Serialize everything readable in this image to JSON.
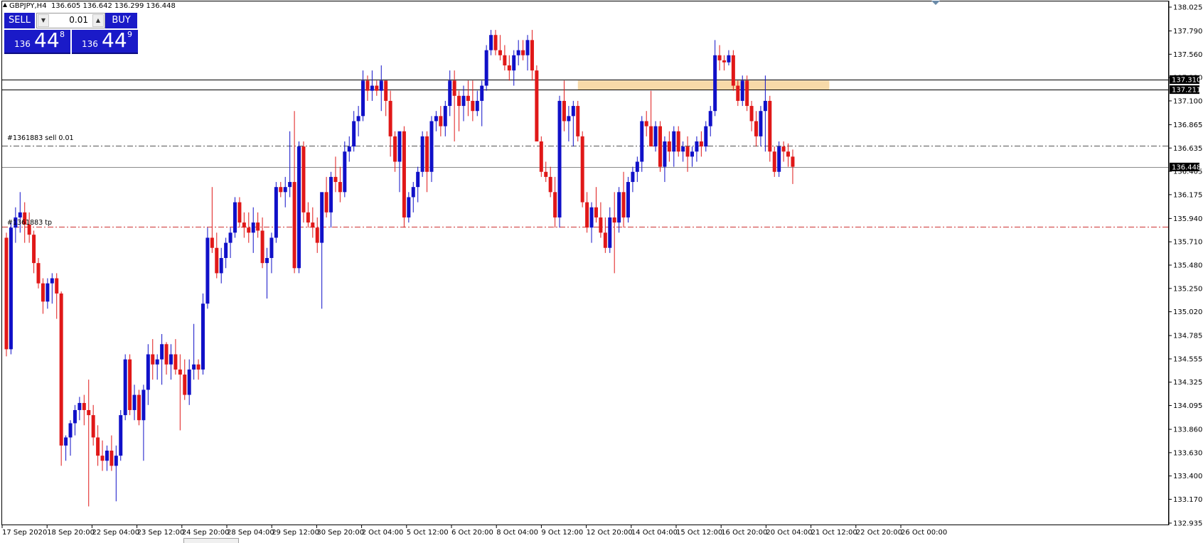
{
  "header": {
    "symbol": "GBPJPY,H4",
    "ohlc": "136.605 136.642 136.299 136.448"
  },
  "trade_panel": {
    "sell_label": "SELL",
    "buy_label": "BUY",
    "lot_value": "0.01",
    "sell_price": {
      "prefix": "136",
      "big": "44",
      "sup": "8"
    },
    "buy_price": {
      "prefix": "136",
      "big": "44",
      "sup": "9"
    }
  },
  "annotations": {
    "order_line_label": "#1361883 sell 0.01",
    "tp_line_label": "#1361883 tp"
  },
  "colors": {
    "bull": "#1010c8",
    "bear": "#e01818",
    "zone": "#f7d9a8",
    "order_line": "#555555",
    "tp_line": "#cc3333"
  },
  "chart_data": {
    "type": "candlestick",
    "symbol": "GBPJPY",
    "timeframe": "H4",
    "ylim": [
      132.935,
      138.025
    ],
    "y_ticks": [
      138.025,
      137.79,
      137.56,
      137.33,
      137.1,
      136.865,
      136.635,
      136.405,
      136.175,
      135.94,
      135.71,
      135.48,
      135.25,
      135.02,
      134.785,
      134.555,
      134.325,
      134.095,
      133.86,
      133.63,
      133.4,
      133.17,
      132.935
    ],
    "x_labels": [
      "17 Sep 2020",
      "18 Sep 20:00",
      "22 Sep 04:00",
      "23 Sep 12:00",
      "24 Sep 20:00",
      "28 Sep 04:00",
      "29 Sep 12:00",
      "30 Sep 20:00",
      "2 Oct 04:00",
      "5 Oct 12:00",
      "6 Oct 20:00",
      "8 Oct 04:00",
      "9 Oct 12:00",
      "12 Oct 20:00",
      "14 Oct 04:00",
      "15 Oct 12:00",
      "16 Oct 20:00",
      "20 Oct 04:00",
      "21 Oct 12:00",
      "22 Oct 20:00",
      "26 Oct 00:00"
    ],
    "horizontal_lines": [
      {
        "price": 137.31,
        "label": "137.310",
        "style": "solid"
      },
      {
        "price": 137.211,
        "label": "137.211",
        "style": "solid"
      },
      {
        "price": 136.448,
        "label": "136.448",
        "style": "bid"
      },
      {
        "price": 136.655,
        "label": "#1361883 sell 0.01",
        "style": "dashdot"
      },
      {
        "price": 135.86,
        "label": "#1361883 tp",
        "style": "dashdot-red"
      }
    ],
    "zone": {
      "from_candle": 125,
      "to_candle": 180,
      "top": 137.3,
      "bottom": 137.21
    },
    "candles": [
      [
        135.75,
        135.8,
        134.58,
        134.65
      ],
      [
        134.65,
        135.9,
        134.6,
        135.85
      ],
      [
        135.85,
        136.05,
        135.7,
        135.95
      ],
      [
        135.95,
        136.2,
        135.8,
        136.0
      ],
      [
        136.0,
        136.1,
        135.7,
        135.88
      ],
      [
        135.88,
        136.0,
        135.7,
        135.78
      ],
      [
        135.78,
        135.82,
        135.4,
        135.5
      ],
      [
        135.5,
        135.55,
        135.25,
        135.3
      ],
      [
        135.3,
        135.35,
        135.0,
        135.12
      ],
      [
        135.12,
        135.35,
        135.05,
        135.3
      ],
      [
        135.3,
        135.4,
        135.1,
        135.35
      ],
      [
        135.35,
        135.4,
        134.95,
        135.2
      ],
      [
        135.2,
        135.22,
        133.5,
        133.7
      ],
      [
        133.7,
        133.8,
        133.55,
        133.78
      ],
      [
        133.78,
        133.95,
        133.6,
        133.92
      ],
      [
        133.92,
        134.1,
        133.8,
        134.05
      ],
      [
        134.05,
        134.18,
        133.95,
        134.12
      ],
      [
        134.12,
        134.2,
        133.9,
        134.05
      ],
      [
        134.05,
        134.35,
        133.1,
        134.0
      ],
      [
        134.0,
        134.1,
        133.7,
        133.78
      ],
      [
        133.78,
        133.9,
        133.5,
        133.6
      ],
      [
        133.6,
        133.75,
        133.45,
        133.55
      ],
      [
        133.55,
        133.7,
        133.45,
        133.65
      ],
      [
        133.65,
        133.8,
        133.45,
        133.5
      ],
      [
        133.5,
        133.7,
        133.15,
        133.6
      ],
      [
        133.6,
        134.05,
        133.55,
        134.0
      ],
      [
        134.0,
        134.6,
        133.95,
        134.55
      ],
      [
        134.55,
        134.6,
        134.0,
        134.05
      ],
      [
        134.05,
        134.3,
        133.95,
        134.2
      ],
      [
        134.2,
        134.25,
        133.9,
        133.95
      ],
      [
        133.95,
        134.3,
        133.55,
        134.25
      ],
      [
        134.25,
        134.7,
        134.1,
        134.6
      ],
      [
        134.6,
        134.75,
        134.35,
        134.5
      ],
      [
        134.5,
        134.6,
        134.35,
        134.55
      ],
      [
        134.55,
        134.8,
        134.3,
        134.7
      ],
      [
        134.7,
        134.72,
        134.4,
        134.5
      ],
      [
        134.5,
        134.7,
        134.35,
        134.6
      ],
      [
        134.6,
        134.75,
        134.4,
        134.45
      ],
      [
        134.45,
        134.6,
        133.85,
        134.4
      ],
      [
        134.4,
        134.55,
        134.15,
        134.2
      ],
      [
        134.2,
        134.55,
        134.1,
        134.45
      ],
      [
        134.45,
        134.9,
        134.35,
        134.5
      ],
      [
        134.5,
        134.55,
        134.35,
        134.45
      ],
      [
        134.45,
        135.2,
        134.4,
        135.1
      ],
      [
        135.1,
        135.85,
        135.05,
        135.75
      ],
      [
        135.75,
        136.25,
        135.6,
        135.65
      ],
      [
        135.65,
        135.8,
        135.35,
        135.4
      ],
      [
        135.4,
        135.65,
        135.3,
        135.55
      ],
      [
        135.55,
        135.75,
        135.45,
        135.7
      ],
      [
        135.7,
        135.85,
        135.55,
        135.8
      ],
      [
        135.8,
        136.15,
        135.75,
        136.1
      ],
      [
        136.1,
        136.15,
        135.85,
        135.9
      ],
      [
        135.9,
        136.0,
        135.75,
        135.85
      ],
      [
        135.85,
        136.0,
        135.7,
        135.8
      ],
      [
        135.8,
        136.05,
        135.6,
        135.9
      ],
      [
        135.9,
        136.0,
        135.75,
        135.82
      ],
      [
        135.82,
        135.95,
        135.45,
        135.5
      ],
      [
        135.5,
        135.65,
        135.15,
        135.55
      ],
      [
        135.55,
        135.8,
        135.4,
        135.75
      ],
      [
        135.75,
        136.3,
        135.7,
        136.25
      ],
      [
        136.25,
        136.3,
        136.15,
        136.2
      ],
      [
        136.2,
        136.35,
        136.05,
        136.25
      ],
      [
        136.25,
        136.8,
        136.15,
        136.3
      ],
      [
        136.3,
        137.0,
        135.4,
        135.45
      ],
      [
        135.45,
        136.7,
        135.4,
        136.65
      ],
      [
        136.65,
        136.7,
        135.9,
        136.0
      ],
      [
        136.0,
        136.1,
        135.85,
        135.9
      ],
      [
        135.9,
        136.05,
        135.75,
        135.85
      ],
      [
        135.85,
        135.95,
        135.6,
        135.7
      ],
      [
        135.7,
        135.95,
        135.05,
        136.2
      ],
      [
        136.2,
        136.35,
        135.95,
        136.0
      ],
      [
        136.0,
        136.4,
        135.85,
        136.35
      ],
      [
        136.35,
        136.55,
        136.2,
        136.3
      ],
      [
        136.3,
        136.45,
        136.1,
        136.2
      ],
      [
        136.2,
        136.7,
        136.15,
        136.6
      ],
      [
        136.6,
        136.75,
        136.5,
        136.65
      ],
      [
        136.65,
        137.0,
        136.6,
        136.9
      ],
      [
        136.9,
        137.05,
        136.75,
        136.95
      ],
      [
        136.95,
        137.4,
        136.9,
        137.3
      ],
      [
        137.3,
        137.35,
        137.1,
        137.2
      ],
      [
        137.2,
        137.4,
        137.1,
        137.25
      ],
      [
        137.25,
        137.3,
        137.15,
        137.2
      ],
      [
        137.2,
        137.45,
        137.0,
        137.3
      ],
      [
        137.3,
        137.3,
        136.95,
        137.1
      ],
      [
        137.1,
        137.2,
        136.55,
        136.75
      ],
      [
        136.75,
        136.8,
        136.4,
        136.5
      ],
      [
        136.5,
        136.6,
        136.2,
        136.8
      ],
      [
        136.8,
        136.85,
        135.85,
        135.95
      ],
      [
        135.95,
        136.2,
        135.9,
        136.15
      ],
      [
        136.15,
        136.3,
        136.0,
        136.25
      ],
      [
        136.25,
        136.45,
        136.1,
        136.4
      ],
      [
        136.4,
        136.8,
        136.35,
        136.75
      ],
      [
        136.75,
        136.8,
        136.2,
        136.4
      ],
      [
        136.4,
        136.95,
        136.3,
        136.9
      ],
      [
        136.9,
        137.0,
        136.8,
        136.95
      ],
      [
        136.95,
        137.05,
        136.75,
        136.85
      ],
      [
        136.85,
        137.1,
        136.75,
        137.05
      ],
      [
        137.05,
        137.4,
        136.95,
        137.3
      ],
      [
        137.3,
        137.4,
        136.7,
        137.15
      ],
      [
        137.15,
        137.2,
        136.8,
        137.05
      ],
      [
        137.05,
        137.25,
        136.9,
        137.15
      ],
      [
        137.15,
        137.3,
        136.95,
        137.1
      ],
      [
        137.1,
        137.3,
        136.9,
        137.0
      ],
      [
        137.0,
        137.2,
        136.95,
        137.1
      ],
      [
        137.1,
        137.3,
        136.85,
        137.25
      ],
      [
        137.25,
        137.65,
        137.2,
        137.6
      ],
      [
        137.6,
        137.8,
        137.55,
        137.75
      ],
      [
        137.75,
        137.8,
        137.55,
        137.6
      ],
      [
        137.6,
        137.75,
        137.5,
        137.55
      ],
      [
        137.55,
        137.65,
        137.4,
        137.45
      ],
      [
        137.45,
        137.55,
        137.3,
        137.4
      ],
      [
        137.4,
        137.6,
        137.25,
        137.55
      ],
      [
        137.55,
        137.7,
        137.45,
        137.6
      ],
      [
        137.6,
        137.7,
        137.5,
        137.55
      ],
      [
        137.55,
        137.75,
        137.4,
        137.7
      ],
      [
        137.7,
        137.8,
        137.3,
        137.4
      ],
      [
        137.4,
        137.45,
        136.7,
        136.7
      ],
      [
        136.7,
        136.75,
        136.35,
        136.4
      ],
      [
        136.4,
        136.5,
        136.3,
        136.35
      ],
      [
        136.35,
        136.45,
        136.15,
        136.2
      ],
      [
        136.2,
        136.35,
        135.85,
        135.95
      ],
      [
        135.95,
        137.15,
        135.85,
        137.1
      ],
      [
        137.1,
        137.3,
        136.8,
        136.9
      ],
      [
        136.9,
        137.05,
        136.7,
        136.95
      ],
      [
        136.95,
        137.1,
        136.65,
        137.05
      ],
      [
        137.05,
        137.1,
        136.7,
        136.75
      ],
      [
        136.75,
        136.8,
        136.05,
        136.1
      ],
      [
        136.1,
        136.2,
        135.8,
        135.85
      ],
      [
        135.85,
        136.1,
        135.7,
        136.05
      ],
      [
        136.05,
        136.25,
        135.9,
        135.95
      ],
      [
        135.95,
        136.1,
        135.75,
        135.8
      ],
      [
        135.8,
        135.95,
        135.6,
        135.65
      ],
      [
        135.65,
        136.05,
        135.6,
        135.95
      ],
      [
        135.95,
        136.2,
        135.4,
        135.9
      ],
      [
        135.9,
        136.25,
        135.8,
        136.2
      ],
      [
        136.2,
        136.4,
        135.85,
        135.95
      ],
      [
        135.95,
        136.35,
        135.9,
        136.3
      ],
      [
        136.3,
        136.45,
        136.2,
        136.4
      ],
      [
        136.4,
        136.55,
        136.3,
        136.5
      ],
      [
        136.5,
        136.95,
        136.4,
        136.9
      ],
      [
        136.9,
        137.0,
        136.75,
        136.85
      ],
      [
        136.85,
        137.2,
        136.65,
        136.65
      ],
      [
        136.65,
        136.9,
        136.6,
        136.85
      ],
      [
        136.85,
        136.9,
        136.4,
        136.45
      ],
      [
        136.45,
        136.75,
        136.3,
        136.7
      ],
      [
        136.7,
        136.8,
        136.5,
        136.6
      ],
      [
        136.6,
        136.85,
        136.45,
        136.8
      ],
      [
        136.8,
        136.85,
        136.55,
        136.6
      ],
      [
        136.6,
        136.7,
        136.5,
        136.65
      ],
      [
        136.65,
        136.75,
        136.4,
        136.55
      ],
      [
        136.55,
        136.65,
        136.45,
        136.6
      ],
      [
        136.6,
        136.75,
        136.5,
        136.7
      ],
      [
        136.7,
        136.8,
        136.55,
        136.65
      ],
      [
        136.65,
        136.9,
        136.6,
        136.85
      ],
      [
        136.85,
        137.05,
        136.75,
        137.0
      ],
      [
        137.0,
        137.7,
        136.95,
        137.55
      ],
      [
        137.55,
        137.65,
        137.4,
        137.5
      ],
      [
        137.5,
        137.55,
        137.4,
        137.48
      ],
      [
        137.48,
        137.6,
        137.45,
        137.55
      ],
      [
        137.55,
        137.6,
        137.2,
        137.25
      ],
      [
        137.25,
        137.3,
        137.05,
        137.1
      ],
      [
        137.1,
        137.35,
        137.05,
        137.3
      ],
      [
        137.3,
        137.35,
        137.0,
        137.05
      ],
      [
        137.05,
        137.1,
        136.8,
        136.9
      ],
      [
        136.9,
        137.0,
        136.65,
        136.75
      ],
      [
        136.75,
        137.05,
        136.65,
        137.0
      ],
      [
        137.0,
        137.35,
        136.6,
        137.1
      ],
      [
        137.1,
        137.15,
        136.5,
        136.6
      ],
      [
        136.6,
        136.65,
        136.35,
        136.4
      ],
      [
        136.4,
        136.7,
        136.35,
        136.65
      ],
      [
        136.65,
        136.7,
        136.5,
        136.6
      ],
      [
        136.6,
        136.68,
        136.45,
        136.55
      ],
      [
        136.55,
        136.62,
        136.28,
        136.45
      ]
    ]
  }
}
